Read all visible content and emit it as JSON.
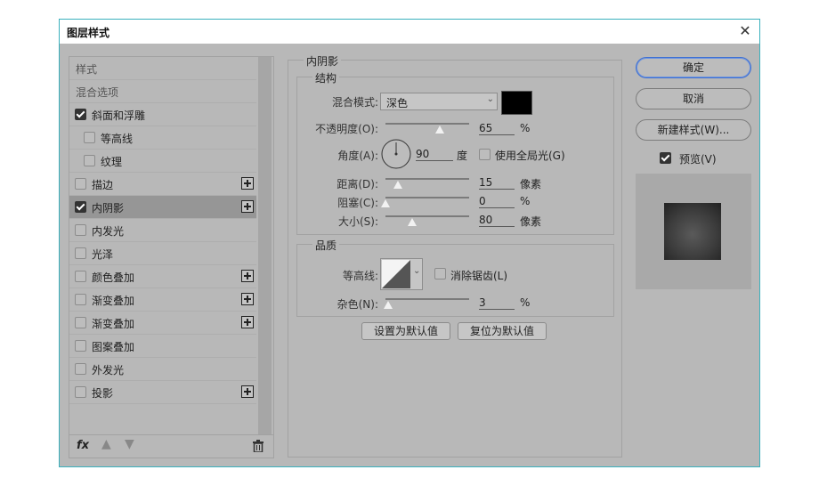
{
  "window": {
    "title": "图层样式",
    "close_glyph": "✕"
  },
  "left_list": {
    "header": "样式",
    "items": [
      {
        "label": "混合选项",
        "checkbox": null,
        "plus": false
      },
      {
        "label": "斜面和浮雕",
        "checkbox": true,
        "plus": false
      },
      {
        "label": "等高线",
        "checkbox": false,
        "plus": false,
        "indent": true
      },
      {
        "label": "纹理",
        "checkbox": false,
        "plus": false,
        "indent": true
      },
      {
        "label": "描边",
        "checkbox": false,
        "plus": true
      },
      {
        "label": "内阴影",
        "checkbox": true,
        "plus": true,
        "selected": true
      },
      {
        "label": "内发光",
        "checkbox": false,
        "plus": false
      },
      {
        "label": "光泽",
        "checkbox": false,
        "plus": false
      },
      {
        "label": "颜色叠加",
        "checkbox": false,
        "plus": true
      },
      {
        "label": "渐变叠加",
        "checkbox": false,
        "plus": true
      },
      {
        "label": "渐变叠加",
        "checkbox": false,
        "plus": true
      },
      {
        "label": "图案叠加",
        "checkbox": false,
        "plus": false
      },
      {
        "label": "外发光",
        "checkbox": false,
        "plus": false
      },
      {
        "label": "投影",
        "checkbox": false,
        "plus": true
      }
    ],
    "footer_fx": "fx"
  },
  "panel": {
    "title": "内阴影",
    "structure": {
      "title": "结构",
      "blend_mode_label": "混合模式:",
      "blend_mode_value": "深色",
      "shadow_color": "#000000",
      "opacity_label": "不透明度(O):",
      "opacity_value": "65",
      "opacity_unit": "%",
      "angle_label": "角度(A):",
      "angle_value": "90",
      "angle_unit": "度",
      "global_light_label": "使用全局光(G)",
      "distance_label": "距离(D):",
      "distance_value": "15",
      "distance_unit": "像素",
      "choke_label": "阻塞(C):",
      "choke_value": "0",
      "choke_unit": "%",
      "size_label": "大小(S):",
      "size_value": "80",
      "size_unit": "像素"
    },
    "quality": {
      "title": "品质",
      "contour_label": "等高线:",
      "antialias_label": "消除锯齿(L)",
      "noise_label": "杂色(N):",
      "noise_value": "3",
      "noise_unit": "%"
    },
    "set_default": "设置为默认值",
    "reset_default": "复位为默认值"
  },
  "right": {
    "ok": "确定",
    "cancel": "取消",
    "new_style": "新建样式(W)...",
    "preview_label": "预览(V)"
  },
  "colors": {
    "accent": "#3d6fd2",
    "dialog_bg": "#b8b8b8",
    "border": "#39b0bd"
  }
}
